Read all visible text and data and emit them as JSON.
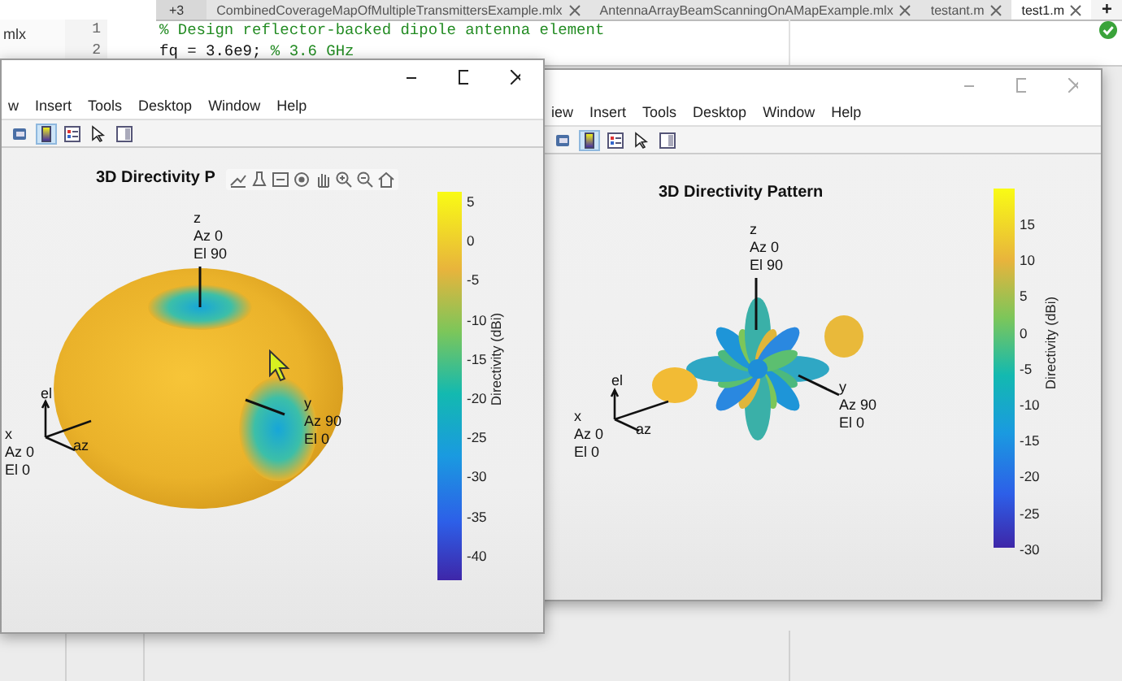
{
  "editor": {
    "overflow_tabs": "+3",
    "tabs": [
      {
        "label": "CombinedCoverageMapOfMultipleTransmittersExample.mlx",
        "selected": false
      },
      {
        "label": "AntennaArrayBeamScanningOnAMapExample.mlx",
        "selected": false
      },
      {
        "label": "testant.m",
        "selected": false
      },
      {
        "label": "test1.m",
        "selected": true
      }
    ],
    "new_tab": "+",
    "side_panel_text": "mlx",
    "lines": [
      {
        "number": "1",
        "comment": "% Design reflector-backed dipole antenna element"
      },
      {
        "number": "2",
        "code": "fq = 3.6e9; ",
        "comment": "% 3.6 GHz"
      }
    ]
  },
  "figures": [
    {
      "active": true,
      "kind": "torus",
      "menu": [
        "w",
        "Insert",
        "Tools",
        "Desktop",
        "Window",
        "Help"
      ],
      "toolbar_buttons": [
        {
          "selected": false
        },
        {
          "selected": true
        },
        {
          "selected": false
        },
        {
          "selected": false
        },
        {
          "selected": false
        }
      ],
      "axes_toolbar": true,
      "title": "3D Directivity P",
      "axis_labels": [
        {
          "name": "z",
          "az": "Az 0",
          "el": "El 90"
        },
        {
          "name": "y",
          "az": "Az 90",
          "el": "El 0"
        },
        {
          "name": "x",
          "az": "Az 0",
          "el": "El 0"
        }
      ],
      "local_axes": [
        "el",
        "az"
      ],
      "colorbar": {
        "ticks": [
          "5",
          "0",
          "-5",
          "-10",
          "-15",
          "-20",
          "-25",
          "-30",
          "-35",
          "-40"
        ],
        "label": "Directivity (dBi)"
      }
    },
    {
      "active": false,
      "kind": "lobes",
      "menu": [
        "iew",
        "Insert",
        "Tools",
        "Desktop",
        "Window",
        "Help"
      ],
      "toolbar_buttons": [
        {
          "selected": false
        },
        {
          "selected": true
        },
        {
          "selected": false
        },
        {
          "selected": false
        },
        {
          "selected": false
        }
      ],
      "axes_toolbar": false,
      "title": "3D Directivity Pattern",
      "axis_labels": [
        {
          "name": "z",
          "az": "Az 0",
          "el": "El 90"
        },
        {
          "name": "y",
          "az": "Az 90",
          "el": "El 0"
        },
        {
          "name": "x",
          "az": "Az 0",
          "el": "El 0"
        }
      ],
      "local_axes": [
        "el",
        "az"
      ],
      "colorbar": {
        "ticks": [
          "15",
          "10",
          "5",
          "0",
          "-5",
          "-10",
          "-15",
          "-20",
          "-25",
          "-30"
        ],
        "label": "Directivity (dBi)"
      }
    }
  ]
}
